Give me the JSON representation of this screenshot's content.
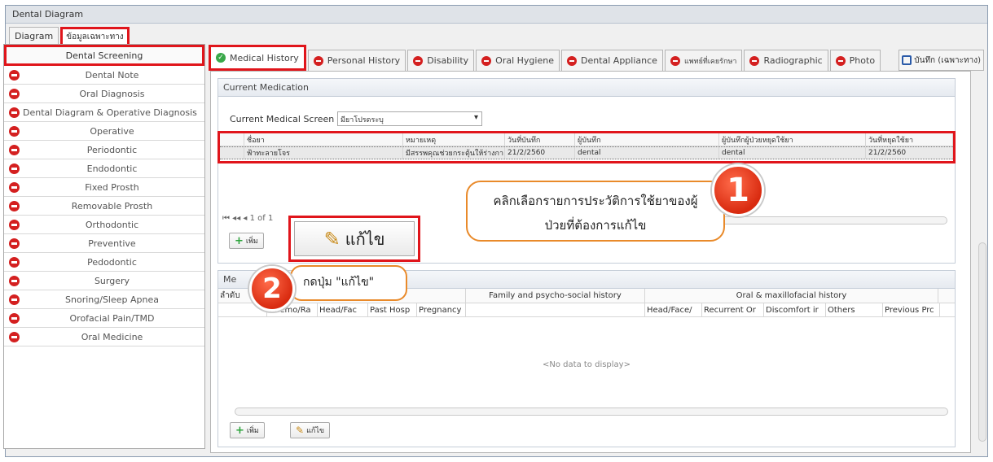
{
  "window": {
    "title": "Dental Diagram"
  },
  "top_tabs": [
    {
      "label": "Diagram",
      "active": false
    },
    {
      "label": "ข้อมูลเฉพาะทาง",
      "active": true
    }
  ],
  "sidebar": {
    "items": [
      {
        "label": "Dental Screening",
        "highlight": true
      },
      {
        "label": "Dental Note"
      },
      {
        "label": "Oral Diagnosis"
      },
      {
        "label": "Dental Diagram & Operative Diagnosis"
      },
      {
        "label": "Operative"
      },
      {
        "label": "Periodontic"
      },
      {
        "label": "Endodontic"
      },
      {
        "label": "Fixed Prosth"
      },
      {
        "label": "Removable Prosth"
      },
      {
        "label": "Orthodontic"
      },
      {
        "label": "Preventive"
      },
      {
        "label": "Pedodontic"
      },
      {
        "label": "Surgery"
      },
      {
        "label": "Snoring/Sleep Apnea"
      },
      {
        "label": "Orofacial Pain/TMD"
      },
      {
        "label": "Oral Medicine"
      }
    ]
  },
  "tabs": [
    {
      "label": "Medical History",
      "active": true,
      "icon": "check-icon"
    },
    {
      "label": "Personal History",
      "icon": "minus-icon"
    },
    {
      "label": "Disability",
      "icon": "minus-icon"
    },
    {
      "label": "Oral Hygiene",
      "icon": "minus-icon"
    },
    {
      "label": "Dental Appliance",
      "icon": "minus-icon"
    },
    {
      "label": "แพทย์ที่เคยรักษา",
      "icon": "minus-icon"
    },
    {
      "label": "Radiographic",
      "icon": "minus-icon"
    },
    {
      "label": "Photo",
      "icon": "minus-icon"
    }
  ],
  "save_tab": {
    "label": "บันทึก (เฉพาะทาง)"
  },
  "current_medication": {
    "header": "Current Medication",
    "screen_label": "Current Medical Screen",
    "screen_value": "มียาโปรดระบุ",
    "columns": [
      "ชื่อยา",
      "หมายเหตุ",
      "วันที่บันทึก",
      "ผู้บันทึก",
      "ผู้บันทึกผู้ป่วยหยุดใช้ยา",
      "วันที่หยุดใช้ยา"
    ],
    "rows": [
      [
        "ฟ้าทะลายโจร",
        "มีสรรพคุณช่วยกระตุ้นให้ร่างกา",
        "21/2/2560",
        "dental",
        "dental",
        "21/2/2560"
      ]
    ],
    "pager": "1 of 1",
    "add_label": "เพิ่ม"
  },
  "edit_big": {
    "label": "แก้ไข"
  },
  "callout1": {
    "line1": "คลิกเลือกรายการประวัติการใช้ยาของผู้",
    "line2": "ป่วยที่ต้องการแก้ไข"
  },
  "callout2": {
    "text": "กดปุ่ม \"แก้ไข\""
  },
  "badges": {
    "one": "1",
    "two": "2"
  },
  "medical_history": {
    "header": "Me",
    "rownum_label": "ลำดับ",
    "group_cols": [
      "Family and psycho-social history",
      "Oral & maxillofacial history"
    ],
    "sub_cols": [
      "Chemo/Ra",
      "Head/Fac",
      "Past Hosp",
      "Pregnancy",
      "Head/Face/",
      "Recurrent Or",
      "Discomfort ir",
      "Others",
      "Previous Prc"
    ],
    "empty": "<No data to display>",
    "add_label": "เพิ่ม",
    "edit_label": "แก้ไข"
  }
}
